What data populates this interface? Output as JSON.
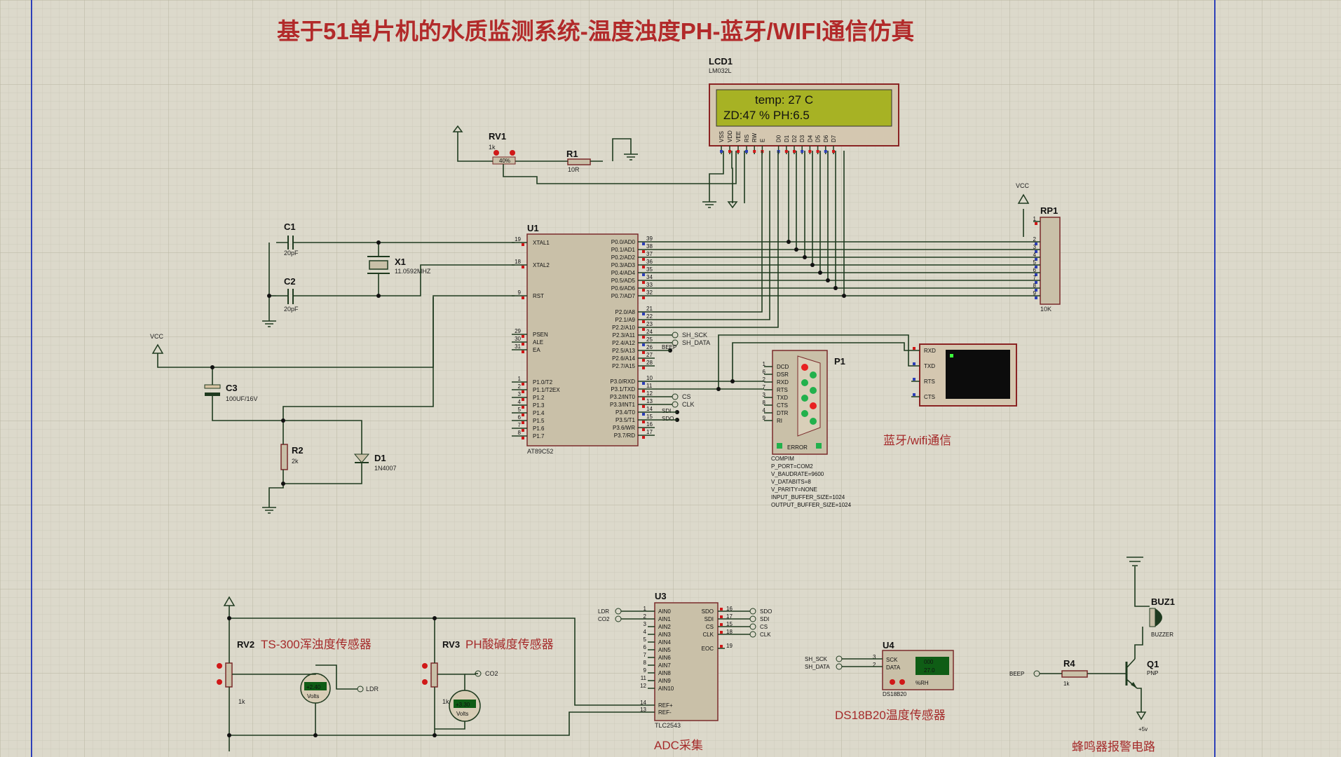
{
  "title": "基于51单片机的水质监测系统-温度浊度PH-蓝牙/WIFI通信仿真",
  "lcd": {
    "ref": "LCD1",
    "part": "LM032L",
    "line1": "temp: 27 C",
    "line2": "ZD:47 %    PH:6.5",
    "pins": [
      "VSS",
      "VDD",
      "VEE",
      "RS",
      "RW",
      "E",
      "D0",
      "D1",
      "D2",
      "D3",
      "D4",
      "D5",
      "D6",
      "D7"
    ]
  },
  "rv1": {
    "ref": "RV1",
    "val": "1k",
    "pct": "40%"
  },
  "r1": {
    "ref": "R1",
    "val": "10R"
  },
  "c1": {
    "ref": "C1",
    "val": "20pF"
  },
  "c2": {
    "ref": "C2",
    "val": "20pF"
  },
  "x1": {
    "ref": "X1",
    "val": "11.0592MHZ"
  },
  "c3": {
    "ref": "C3",
    "val": "100UF/16V"
  },
  "r2": {
    "ref": "R2",
    "val": "2k"
  },
  "d1": {
    "ref": "D1",
    "val": "1N4007"
  },
  "vcc": "VCC",
  "u1": {
    "ref": "U1",
    "part": "AT89C52",
    "left_pins": [
      {
        "num": "19",
        "name": "XTAL1"
      },
      {
        "num": "18",
        "name": "XTAL2"
      },
      {
        "num": "9",
        "name": "RST"
      },
      {
        "num": "29",
        "name": "PSEN"
      },
      {
        "num": "30",
        "name": "ALE"
      },
      {
        "num": "31",
        "name": "EA"
      },
      {
        "num": "1",
        "name": "P1.0/T2"
      },
      {
        "num": "2",
        "name": "P1.1/T2EX"
      },
      {
        "num": "3",
        "name": "P1.2"
      },
      {
        "num": "4",
        "name": "P1.3"
      },
      {
        "num": "5",
        "name": "P1.4"
      },
      {
        "num": "6",
        "name": "P1.5"
      },
      {
        "num": "7",
        "name": "P1.6"
      },
      {
        "num": "8",
        "name": "P1.7"
      }
    ],
    "right_pins": [
      {
        "num": "39",
        "name": "P0.0/AD0"
      },
      {
        "num": "38",
        "name": "P0.1/AD1"
      },
      {
        "num": "37",
        "name": "P0.2/AD2"
      },
      {
        "num": "36",
        "name": "P0.3/AD3"
      },
      {
        "num": "35",
        "name": "P0.4/AD4"
      },
      {
        "num": "34",
        "name": "P0.5/AD5"
      },
      {
        "num": "33",
        "name": "P0.6/AD6"
      },
      {
        "num": "32",
        "name": "P0.7/AD7"
      },
      {
        "num": "21",
        "name": "P2.0/A8"
      },
      {
        "num": "22",
        "name": "P2.1/A9"
      },
      {
        "num": "23",
        "name": "P2.2/A10"
      },
      {
        "num": "24",
        "name": "P2.3/A11"
      },
      {
        "num": "25",
        "name": "P2.4/A12"
      },
      {
        "num": "26",
        "name": "P2.5/A13"
      },
      {
        "num": "27",
        "name": "P2.6/A14"
      },
      {
        "num": "28",
        "name": "P2.7/A15"
      },
      {
        "num": "10",
        "name": "P3.0/RXD"
      },
      {
        "num": "11",
        "name": "P3.1/TXD"
      },
      {
        "num": "12",
        "name": "P3.2/INT0"
      },
      {
        "num": "13",
        "name": "P3.3/INT1"
      },
      {
        "num": "14",
        "name": "P3.4/T0"
      },
      {
        "num": "15",
        "name": "P3.5/T1"
      },
      {
        "num": "16",
        "name": "P3.6/WR"
      },
      {
        "num": "17",
        "name": "P3.7/RD"
      }
    ],
    "net_labels": [
      "SH_SCK",
      "SH_DATA",
      "BEEP",
      "CS",
      "CLK",
      "SDI",
      "SDO"
    ]
  },
  "rp1": {
    "ref": "RP1",
    "val": "10K",
    "pins": [
      "1",
      "2",
      "3",
      "4",
      "5",
      "6",
      "7",
      "8",
      "9"
    ]
  },
  "p1": {
    "ref": "P1",
    "part": "COMPIM",
    "error": "ERROR",
    "pins": [
      {
        "num": "1",
        "name": "DCD"
      },
      {
        "num": "6",
        "name": "DSR"
      },
      {
        "num": "2",
        "name": "RXD"
      },
      {
        "num": "7",
        "name": "RTS"
      },
      {
        "num": "3",
        "name": "TXD"
      },
      {
        "num": "8",
        "name": "CTS"
      },
      {
        "num": "4",
        "name": "DTR"
      },
      {
        "num": "9",
        "name": "RI"
      }
    ],
    "props": [
      "P_PORT=COM2",
      "V_BAUDRATE=9600",
      "V_DATABITS=8",
      "V_PARITY=NONE",
      "INPUT_BUFFER_SIZE=1024",
      "OUTPUT_BUFFER_SIZE=1024"
    ]
  },
  "terminal": {
    "pins": [
      "RXD",
      "TXD",
      "RTS",
      "CTS"
    ]
  },
  "caption_bt": "蓝牙/wifi通信",
  "rv2": {
    "ref": "RV2",
    "caption": "TS-300浑浊度传感器",
    "val": "1k",
    "volts": "+2.40",
    "unit": "Volts",
    "net": "LDR"
  },
  "rv3": {
    "ref": "RV3",
    "caption": "PH酸碱度传感器",
    "val": "1k",
    "volts": "+3.30",
    "unit": "Volts",
    "net": "CO2"
  },
  "u3": {
    "ref": "U3",
    "part": "TLC2543",
    "caption": "ADC采集",
    "left_pins": [
      {
        "num": "1",
        "name": "AIN0"
      },
      {
        "num": "2",
        "name": "AIN1"
      },
      {
        "num": "3",
        "name": "AIN2"
      },
      {
        "num": "4",
        "name": "AIN3"
      },
      {
        "num": "5",
        "name": "AIN4"
      },
      {
        "num": "6",
        "name": "AIN5"
      },
      {
        "num": "7",
        "name": "AIN6"
      },
      {
        "num": "8",
        "name": "AIN7"
      },
      {
        "num": "9",
        "name": "AIN8"
      },
      {
        "num": "11",
        "name": "AIN9"
      },
      {
        "num": "12",
        "name": "AIN10"
      },
      {
        "num": "14",
        "name": "REF+"
      },
      {
        "num": "13",
        "name": "REF-"
      }
    ],
    "right_pins": [
      {
        "num": "16",
        "name": "SDO"
      },
      {
        "num": "17",
        "name": "SDI"
      },
      {
        "num": "15",
        "name": "CS"
      },
      {
        "num": "18",
        "name": "CLK"
      },
      {
        "num": "19",
        "name": "EOC"
      }
    ],
    "left_nets": [
      "LDR",
      "CO2"
    ],
    "right_nets": [
      "SDO",
      "SDI",
      "CS",
      "CLK"
    ]
  },
  "u4": {
    "ref": "U4",
    "part": "DS18B20",
    "caption": "DS18B20温度传感器",
    "pins": [
      {
        "num": "3",
        "name": "SCK"
      },
      {
        "num": "2",
        "name": "DATA"
      }
    ],
    "nets": [
      "SH_SCK",
      "SH_DATA"
    ],
    "display": "000",
    "display2": "27.0",
    "unit": "%RH"
  },
  "buz": {
    "ref": "BUZ1",
    "part": "BUZZER"
  },
  "r4": {
    "ref": "R4",
    "val": "1k"
  },
  "q1": {
    "ref": "Q1",
    "part": "PNP",
    "supply": "+5v"
  },
  "beep_net": "BEEP",
  "caption_buz": "蜂鸣器报警电路"
}
